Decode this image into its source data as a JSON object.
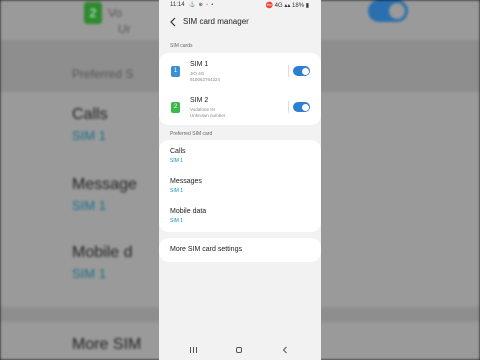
{
  "status_bar": {
    "time": "11:14",
    "icons": "⚓ ⊕ ▫ •",
    "right": "⛔ 4G ▴▴ 18% ▮"
  },
  "header": {
    "title": "SIM card manager"
  },
  "sim_cards": {
    "section_label": "SIM cards",
    "items": [
      {
        "name": "SIM 1",
        "line1": "JIO 4G",
        "line2": "918062764324",
        "icon_label": "1",
        "color": "#3a8fd9",
        "enabled": true
      },
      {
        "name": "SIM 2",
        "line1": "Vodafone IN",
        "line2": "Unknown number",
        "icon_label": "2",
        "color": "#3cb94a",
        "enabled": true
      }
    ]
  },
  "preferred": {
    "section_label": "Preferred SIM card",
    "items": [
      {
        "label": "Calls",
        "value": "SIM 1"
      },
      {
        "label": "Messages",
        "value": "SIM 1"
      },
      {
        "label": "Mobile data",
        "value": "SIM 1"
      }
    ]
  },
  "more": {
    "label": "More SIM card settings"
  },
  "background": {
    "top_sub": "Vo",
    "top_sub2": "Ur",
    "section": "Preferred S",
    "items": [
      {
        "label": "Calls",
        "value": "SIM 1"
      },
      {
        "label": "Message",
        "value": "SIM 1"
      },
      {
        "label": "Mobile d",
        "value": "SIM 1"
      }
    ],
    "more": "More SIM",
    "sim2_badge": "2"
  },
  "accent_color": "#2d7fd3",
  "link_color": "#1a8fb3"
}
